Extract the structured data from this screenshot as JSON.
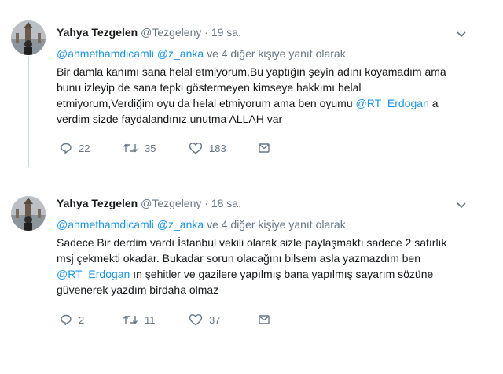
{
  "tweets": [
    {
      "name": "Yahya Tezgelen",
      "handle": "@Tezgeleny",
      "separator": "·",
      "time": "19 sa.",
      "replying_mention1": "@ahmethamdicamli",
      "replying_mention2": "@z_anka",
      "replying_suffix": "ve 4 diğer kişiye yanıt olarak",
      "line1": "Bir damla kanımı sana helal etmiyorum,Bu yaptığın şeyin adını koyamadım ama",
      "line2": "bunu izleyip de sana tepki göstermeyen kimseye hakkımı helal",
      "line3_a": "etmiyorum,Verdiğim oyu da helal etmiyorum ama ben oyumu ",
      "line3_mention": "@RT_Erdogan",
      "line3_b": " a",
      "line4": "verdim sizde faydalandınız unutma ALLAH var",
      "reply_count": "22",
      "retweet_count": "35",
      "like_count": "183"
    },
    {
      "name": "Yahya Tezgelen",
      "handle": "@Tezgeleny",
      "separator": "·",
      "time": "18 sa.",
      "replying_mention1": "@ahmethamdicamli",
      "replying_mention2": "@z_anka",
      "replying_suffix": "ve 4 diğer kişiye yanıt olarak",
      "line1": "Sadece Bir derdim vardı İstanbul vekili olarak sizle paylaşmaktı sadece 2 satırlık",
      "line2": "msj çekmekti okadar. Bukadar sorun olacağını bilsem asla yazmazdım ben",
      "line3_mention": "@RT_Erdogan",
      "line3_b": " ın şehitler ve gazilere yapılmış bana yapılmış sayarım sözüne",
      "line4": "güvenerek yazdım birdaha olmaz",
      "reply_count": "2",
      "retweet_count": "11",
      "like_count": "37"
    }
  ],
  "icons": [
    "reply-icon",
    "retweet-icon",
    "like-icon",
    "dm-icon",
    "chevron-down-icon"
  ],
  "colors": {
    "mention": "#1b95e0",
    "muted": "#657786",
    "text": "#14171a",
    "thread_line": "#ccd6dd"
  }
}
